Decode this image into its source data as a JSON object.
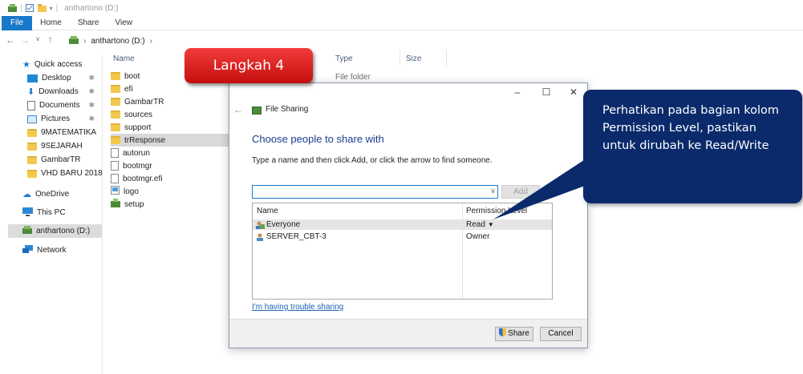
{
  "window": {
    "title": "anthartono (D:)"
  },
  "ribbon": {
    "tabs": [
      "File",
      "Home",
      "Share",
      "View"
    ]
  },
  "address": {
    "crumbs": [
      "anthartono (D:)"
    ]
  },
  "nav": {
    "items": [
      {
        "label": "Quick access"
      },
      {
        "label": "Desktop"
      },
      {
        "label": "Downloads"
      },
      {
        "label": "Documents"
      },
      {
        "label": "Pictures"
      },
      {
        "label": "9MATEMATIKA"
      },
      {
        "label": "9SEJARAH"
      },
      {
        "label": "GambarTR"
      },
      {
        "label": "VHD BARU 2018"
      },
      {
        "label": "OneDrive"
      },
      {
        "label": "This PC"
      },
      {
        "label": "anthartono (D:)"
      },
      {
        "label": "Network"
      }
    ]
  },
  "columns": {
    "name": "Name",
    "type": "Type",
    "size": "Size"
  },
  "files": [
    {
      "name": "boot"
    },
    {
      "name": "efi"
    },
    {
      "name": "GambarTR"
    },
    {
      "name": "sources"
    },
    {
      "name": "support"
    },
    {
      "name": "trResponse"
    },
    {
      "name": "autorun"
    },
    {
      "name": "bootmgr"
    },
    {
      "name": "bootmgr.efi"
    },
    {
      "name": "logo"
    },
    {
      "name": "setup"
    }
  ],
  "file_type_visible": "File folder",
  "dialog": {
    "title": "File Sharing",
    "heading": "Choose people to share with",
    "instruction": "Type a name and then click Add, or click the arrow to find someone.",
    "add_label": "Add",
    "table": {
      "col_name": "Name",
      "col_permission": "Permission Level",
      "rows": [
        {
          "name": "Everyone",
          "permission": "Read"
        },
        {
          "name": "SERVER_CBT-3",
          "permission": "Owner"
        }
      ]
    },
    "trouble_link": "I'm having trouble sharing",
    "share_label": "Share",
    "cancel_label": "Cancel"
  },
  "badge": {
    "label": "Langkah 4"
  },
  "callout": {
    "text": "Perhatikan pada bagian kolom Permission Level, pastikan untuk dirubah ke Read/Write"
  },
  "colors": {
    "file_tab": "#1979ca",
    "badge_red": "#d91c1c",
    "callout_navy": "#0a2a6b",
    "heading_blue": "#1a3d8f"
  }
}
